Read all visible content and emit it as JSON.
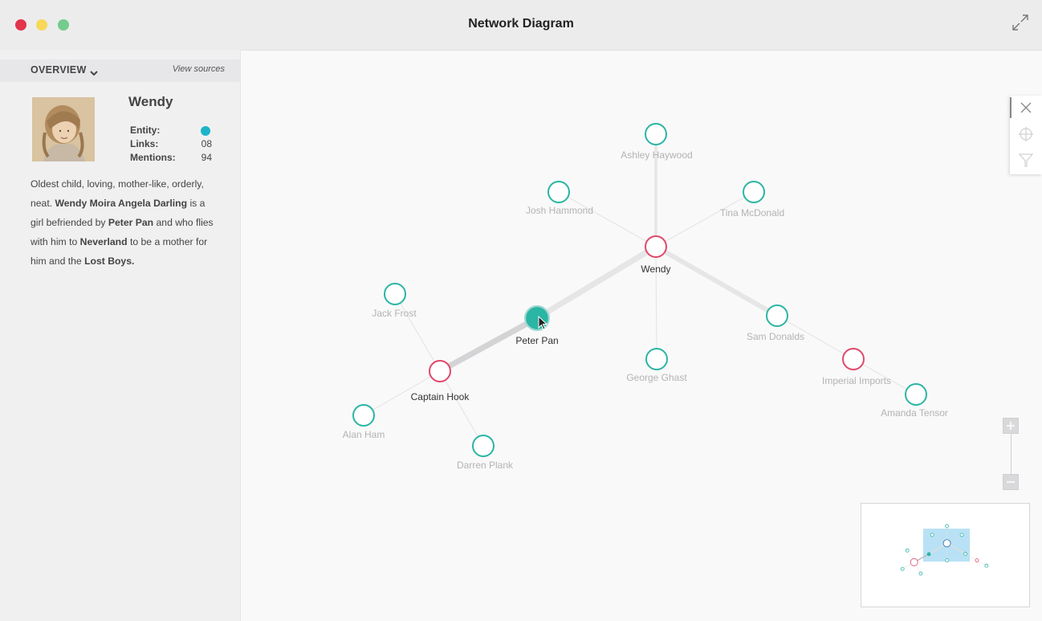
{
  "window": {
    "title": "Network Diagram"
  },
  "sidebar": {
    "overview_label": "OVERVIEW",
    "view_sources_label": "View sources",
    "entity": {
      "name": "Wendy",
      "entity_label": "Entity:",
      "entity_color": "#1bb4c9",
      "links_label": "Links:",
      "links_value": "08",
      "mentions_label": "Mentions:",
      "mentions_value": "94"
    },
    "description": {
      "p1": "Oldest child, loving, mother-like, orderly, neat. ",
      "b1": "Wendy Moira Angela Darling",
      "p2": " is a girl befriended by ",
      "b2": "Peter Pan",
      "p3": " and who flies with him to ",
      "b3": "Neverland",
      "p4": " to be a mother for him and the ",
      "b4": "Lost Boys."
    }
  },
  "colors": {
    "person_node": "#2bb5a5",
    "organization_node": "#e0486a",
    "selected_node_fill": "#2bb5a5",
    "edge": "#e6e6e6",
    "edge_highlight": "#d4d4d6",
    "label_faded": "#b3b3b3",
    "label_active": "#333333"
  },
  "network": {
    "nodes": [
      {
        "id": "wendy",
        "label": "Wendy",
        "kind": "org",
        "active": true
      },
      {
        "id": "ashley",
        "label": "Ashley Haywood",
        "kind": "person",
        "active": false
      },
      {
        "id": "josh",
        "label": "Josh Hammond",
        "kind": "person",
        "active": false
      },
      {
        "id": "tina",
        "label": "Tina McDonald",
        "kind": "person",
        "active": false
      },
      {
        "id": "sam",
        "label": "Sam Donalds",
        "kind": "person",
        "active": false
      },
      {
        "id": "george",
        "label": "George Ghast",
        "kind": "person",
        "active": false
      },
      {
        "id": "imperial",
        "label": "Imperial Imports",
        "kind": "org",
        "active": false
      },
      {
        "id": "amanda",
        "label": "Amanda Tensor",
        "kind": "person",
        "active": false
      },
      {
        "id": "peter",
        "label": "Peter Pan",
        "kind": "person",
        "active": true,
        "selected": true
      },
      {
        "id": "hook",
        "label": "Captain Hook",
        "kind": "org",
        "active": true
      },
      {
        "id": "jack",
        "label": "Jack Frost",
        "kind": "person",
        "active": false
      },
      {
        "id": "alan",
        "label": "Alan Ham",
        "kind": "person",
        "active": false
      },
      {
        "id": "darren",
        "label": "Darren Plank",
        "kind": "person",
        "active": false
      }
    ],
    "edges": [
      {
        "from": "wendy",
        "to": "ashley",
        "weight": 3
      },
      {
        "from": "wendy",
        "to": "josh",
        "weight": 1
      },
      {
        "from": "wendy",
        "to": "tina",
        "weight": 1
      },
      {
        "from": "wendy",
        "to": "george",
        "weight": 1
      },
      {
        "from": "wendy",
        "to": "sam",
        "weight": 5
      },
      {
        "from": "sam",
        "to": "imperial",
        "weight": 1
      },
      {
        "from": "imperial",
        "to": "amanda",
        "weight": 1
      },
      {
        "from": "wendy",
        "to": "peter",
        "weight": 6
      },
      {
        "from": "peter",
        "to": "hook",
        "weight": 6,
        "highlight": true
      },
      {
        "from": "hook",
        "to": "jack",
        "weight": 1
      },
      {
        "from": "hook",
        "to": "alan",
        "weight": 1
      },
      {
        "from": "hook",
        "to": "darren",
        "weight": 1
      }
    ]
  },
  "toolbox": {
    "tools": [
      "close-icon",
      "crosshair-icon",
      "filter-icon"
    ]
  },
  "zoom": {
    "in_icon": "plus-icon",
    "out_icon": "minus-icon"
  }
}
